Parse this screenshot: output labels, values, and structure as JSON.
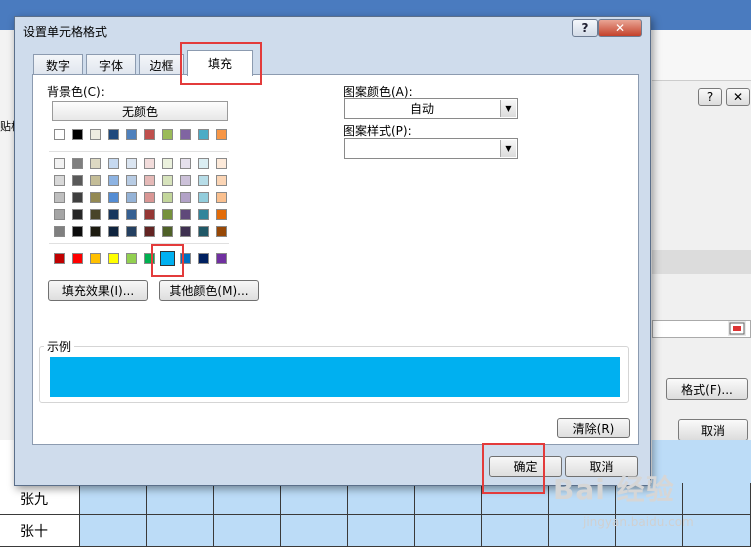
{
  "dialog": {
    "title": "设置单元格格式",
    "help_label": "?",
    "close_label": "✕",
    "tabs": [
      {
        "label": "数字",
        "active": false
      },
      {
        "label": "字体",
        "active": false
      },
      {
        "label": "边框",
        "active": false
      },
      {
        "label": "填充",
        "active": true
      }
    ],
    "background_color_label": "背景色(C):",
    "no_color_label": "无颜色",
    "fill_effects_label": "填充效果(I)...",
    "more_colors_label": "其他颜色(M)...",
    "pattern_color_label": "图案颜色(A):",
    "pattern_color_value": "自动",
    "pattern_style_label": "图案样式(P):",
    "pattern_style_value": "",
    "sample_label": "示例",
    "sample_color": "#00b0f0",
    "clear_label": "清除(R)",
    "ok_label": "确定",
    "cancel_label": "取消"
  },
  "palette": {
    "theme_top": [
      "#ffffff",
      "#000000",
      "#eeece1",
      "#1f497d",
      "#4f81bd",
      "#c0504d",
      "#9bbb59",
      "#8064a2",
      "#4bacc6",
      "#f79646"
    ],
    "theme_rows": [
      [
        "#f2f2f2",
        "#7f7f7f",
        "#ddd9c3",
        "#c6d9f0",
        "#dbe5f1",
        "#f2dcdb",
        "#ebf1dd",
        "#e5e0ec",
        "#dbeef3",
        "#fdeada"
      ],
      [
        "#d8d8d8",
        "#595959",
        "#c4bd97",
        "#8db3e2",
        "#b8cce4",
        "#e5b9b7",
        "#d7e3bc",
        "#ccc1d9",
        "#b7dde8",
        "#fbd5b5"
      ],
      [
        "#bfbfbf",
        "#3f3f3f",
        "#938953",
        "#548dd4",
        "#95b3d7",
        "#d99694",
        "#c3d69b",
        "#b2a2c7",
        "#92cddc",
        "#fac08f"
      ],
      [
        "#a5a5a5",
        "#262626",
        "#494429",
        "#17365d",
        "#366092",
        "#953734",
        "#76923c",
        "#5f497a",
        "#31859b",
        "#e36c09"
      ],
      [
        "#7f7f7f",
        "#0c0c0c",
        "#1d1b10",
        "#0f243e",
        "#244061",
        "#632423",
        "#4f6128",
        "#3f3151",
        "#205867",
        "#974806"
      ]
    ],
    "standard": [
      "#c00000",
      "#ff0000",
      "#ffc000",
      "#ffff00",
      "#92d050",
      "#00b050",
      "#00b0f0",
      "#0070c0",
      "#002060",
      "#7030a0"
    ],
    "selected_standard_index": 6
  },
  "background_sheet": {
    "rows": [
      "张九",
      "张十"
    ],
    "right_buttons": {
      "format_label": "格式(F)...",
      "cancel_label": "取消",
      "help_label": "?",
      "close_label": "✕"
    },
    "left_labels": {
      "paste_label": "贴板"
    }
  },
  "watermark": {
    "brand": "Bai 经验",
    "url": "jingyan.baidu.com"
  }
}
